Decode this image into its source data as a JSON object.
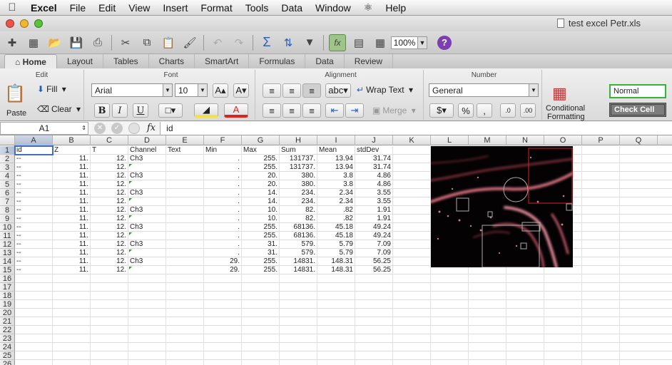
{
  "menubar": {
    "app": "Excel",
    "items": [
      "File",
      "Edit",
      "View",
      "Insert",
      "Format",
      "Tools",
      "Data",
      "Window",
      "Help"
    ]
  },
  "window": {
    "title": "test excel Petr.xls"
  },
  "toolbar": {
    "zoom": "100%"
  },
  "ribbon_tabs": [
    "Home",
    "Layout",
    "Tables",
    "Charts",
    "SmartArt",
    "Formulas",
    "Data",
    "Review"
  ],
  "ribbon": {
    "edit": {
      "title": "Edit",
      "paste": "Paste",
      "fill": "Fill",
      "clear": "Clear"
    },
    "font": {
      "title": "Font",
      "name": "Arial",
      "size": "10"
    },
    "alignment": {
      "title": "Alignment",
      "wrap": "Wrap Text",
      "merge": "Merge"
    },
    "number": {
      "title": "Number",
      "format": "General"
    },
    "format": {
      "conditional_1": "Conditional",
      "conditional_2": "Formatting",
      "normal": "Normal",
      "check_cell": "Check Cell"
    }
  },
  "formula_bar": {
    "cell_ref": "A1",
    "content": "id"
  },
  "columns": [
    "A",
    "B",
    "C",
    "D",
    "E",
    "F",
    "G",
    "H",
    "I",
    "J",
    "K",
    "L",
    "M",
    "N",
    "O",
    "P",
    "Q"
  ],
  "rows": [
    [
      "id",
      "Z",
      "T",
      "Channel",
      "Text",
      "Min",
      "Max",
      "Sum",
      "Mean",
      "stdDev"
    ],
    [
      "--",
      "11.",
      "12.",
      "Ch3",
      "",
      ".",
      "255.",
      "131737.",
      "13.94",
      "31.74"
    ],
    [
      "--",
      "11.",
      "12.",
      "",
      "",
      ".",
      "255.",
      "131737.",
      "13.94",
      "31.74"
    ],
    [
      "--",
      "11.",
      "12.",
      "Ch3",
      "",
      ".",
      "20.",
      "380.",
      "3.8",
      "4.86"
    ],
    [
      "--",
      "11.",
      "12.",
      "",
      "",
      ".",
      "20.",
      "380.",
      "3.8",
      "4.86"
    ],
    [
      "--",
      "11.",
      "12.",
      "Ch3",
      "",
      ".",
      "14.",
      "234.",
      "2.34",
      "3.55"
    ],
    [
      "--",
      "11.",
      "12.",
      "",
      "",
      ".",
      "14.",
      "234.",
      "2.34",
      "3.55"
    ],
    [
      "--",
      "11.",
      "12.",
      "Ch3",
      "",
      ".",
      "10.",
      "82.",
      ".82",
      "1.91"
    ],
    [
      "--",
      "11.",
      "12.",
      "",
      "",
      ".",
      "10.",
      "82.",
      ".82",
      "1.91"
    ],
    [
      "--",
      "11.",
      "12.",
      "Ch3",
      "",
      ".",
      "255.",
      "68136.",
      "45.18",
      "49.24"
    ],
    [
      "--",
      "11.",
      "12.",
      "",
      "",
      ".",
      "255.",
      "68136.",
      "45.18",
      "49.24"
    ],
    [
      "--",
      "11.",
      "12.",
      "Ch3",
      "",
      ".",
      "31.",
      "579.",
      "5.79",
      "7.09"
    ],
    [
      "--",
      "11.",
      "12.",
      "",
      "",
      ".",
      "31.",
      "579.",
      "5.79",
      "7.09"
    ],
    [
      "--",
      "11.",
      "12.",
      "Ch3",
      "",
      "29.",
      "255.",
      "14831.",
      "148.31",
      "56.25"
    ],
    [
      "--",
      "11.",
      "12.",
      "",
      "",
      "29.",
      "255.",
      "14831.",
      "148.31",
      "56.25"
    ]
  ],
  "flag_rows": [
    2,
    4,
    6,
    8,
    10,
    12,
    14
  ],
  "row_count": 26,
  "colors": {
    "selection": "#3f6fbf",
    "flag": "#2a9a2a",
    "normal_style_border": "#37b437",
    "check_cell_bg": "#7d7d7d"
  }
}
